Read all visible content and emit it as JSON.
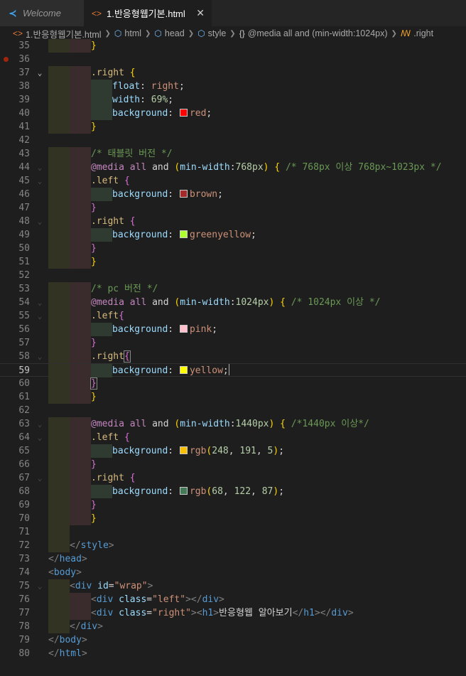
{
  "tabs": [
    {
      "label": "Welcome",
      "icon": "vscode-logo-icon",
      "active": false
    },
    {
      "label": "1.반응형웹기본.html",
      "icon": "html-file-icon",
      "active": true,
      "close": "✕"
    }
  ],
  "breadcrumbs": [
    "1.반응형웹기본.html",
    "html",
    "head",
    "style",
    "@media all and (min-width:1024px)",
    ".right"
  ],
  "lines": [
    {
      "n": "35",
      "ind": 2,
      "tokens": [
        {
          "t": "}",
          "c": "t-b1"
        }
      ]
    },
    {
      "n": "36",
      "ind": 0,
      "tokens": [],
      "breakpoint": true
    },
    {
      "n": "37",
      "ind": 2,
      "fold": "open",
      "tokens": [
        {
          "t": ".right",
          "c": "t-sel"
        },
        {
          "t": " "
        },
        {
          "t": "{",
          "c": "t-b1"
        }
      ]
    },
    {
      "n": "38",
      "ind": 3,
      "tokens": [
        {
          "t": "float",
          "c": "t-prop"
        },
        {
          "t": ": "
        },
        {
          "t": "right",
          "c": "t-val"
        },
        {
          "t": ";"
        }
      ]
    },
    {
      "n": "39",
      "ind": 3,
      "tokens": [
        {
          "t": "width",
          "c": "t-prop"
        },
        {
          "t": ": "
        },
        {
          "t": "69%",
          "c": "t-num"
        },
        {
          "t": ";"
        }
      ]
    },
    {
      "n": "40",
      "ind": 3,
      "tokens": [
        {
          "t": "background",
          "c": "t-prop"
        },
        {
          "t": ": "
        },
        {
          "sw": "#ff0000"
        },
        {
          "t": "red",
          "c": "t-val"
        },
        {
          "t": ";"
        }
      ]
    },
    {
      "n": "41",
      "ind": 2,
      "tokens": [
        {
          "t": "}",
          "c": "t-b1"
        }
      ]
    },
    {
      "n": "42",
      "ind": 0,
      "tokens": []
    },
    {
      "n": "43",
      "ind": 2,
      "tokens": [
        {
          "t": "/* 태블릿 버전 */",
          "c": "t-com"
        }
      ]
    },
    {
      "n": "44",
      "ind": 2,
      "fold": "dim",
      "tokens": [
        {
          "t": "@media",
          "c": "t-at"
        },
        {
          "t": " all ",
          "c": "t-at"
        },
        {
          "t": "and",
          "c": "t-txt"
        },
        {
          "t": " "
        },
        {
          "t": "(",
          "c": "t-b1"
        },
        {
          "t": "min-width",
          "c": "t-prop"
        },
        {
          "t": ":"
        },
        {
          "t": "768px",
          "c": "t-num"
        },
        {
          "t": ")",
          "c": "t-b1"
        },
        {
          "t": " "
        },
        {
          "t": "{",
          "c": "t-b1"
        },
        {
          "t": " /* 768px 이상 768px~1023px */",
          "c": "t-com"
        }
      ]
    },
    {
      "n": "45",
      "ind": 2,
      "fold": "dim",
      "tokens": [
        {
          "t": ".left",
          "c": "t-sel"
        },
        {
          "t": " "
        },
        {
          "t": "{",
          "c": "t-b2"
        }
      ]
    },
    {
      "n": "46",
      "ind": 3,
      "tokens": [
        {
          "t": "background",
          "c": "t-prop"
        },
        {
          "t": ": "
        },
        {
          "sw": "#a52a2a"
        },
        {
          "t": "brown",
          "c": "t-val"
        },
        {
          "t": ";"
        }
      ]
    },
    {
      "n": "47",
      "ind": 2,
      "tokens": [
        {
          "t": "}",
          "c": "t-b2"
        }
      ]
    },
    {
      "n": "48",
      "ind": 2,
      "fold": "dim",
      "tokens": [
        {
          "t": ".right",
          "c": "t-sel"
        },
        {
          "t": " "
        },
        {
          "t": "{",
          "c": "t-b2"
        }
      ]
    },
    {
      "n": "49",
      "ind": 3,
      "tokens": [
        {
          "t": "background",
          "c": "t-prop"
        },
        {
          "t": ": "
        },
        {
          "sw": "#adff2f"
        },
        {
          "t": "greenyellow",
          "c": "t-val"
        },
        {
          "t": ";"
        }
      ]
    },
    {
      "n": "50",
      "ind": 2,
      "tokens": [
        {
          "t": "}",
          "c": "t-b2"
        }
      ]
    },
    {
      "n": "51",
      "ind": 2,
      "tokens": [
        {
          "t": "}",
          "c": "t-b1"
        }
      ]
    },
    {
      "n": "52",
      "ind": 0,
      "tokens": []
    },
    {
      "n": "53",
      "ind": 2,
      "tokens": [
        {
          "t": "/* pc 버전 */",
          "c": "t-com"
        }
      ]
    },
    {
      "n": "54",
      "ind": 2,
      "fold": "dim",
      "tokens": [
        {
          "t": "@media",
          "c": "t-at"
        },
        {
          "t": " all ",
          "c": "t-at"
        },
        {
          "t": "and",
          "c": "t-txt"
        },
        {
          "t": " "
        },
        {
          "t": "(",
          "c": "t-b1"
        },
        {
          "t": "min-width",
          "c": "t-prop"
        },
        {
          "t": ":"
        },
        {
          "t": "1024px",
          "c": "t-num"
        },
        {
          "t": ")",
          "c": "t-b1"
        },
        {
          "t": " "
        },
        {
          "t": "{",
          "c": "t-b1"
        },
        {
          "t": " /* 1024px 이상 */",
          "c": "t-com"
        }
      ]
    },
    {
      "n": "55",
      "ind": 2,
      "fold": "dim",
      "tokens": [
        {
          "t": ".left",
          "c": "t-sel"
        },
        {
          "t": "{",
          "c": "t-b2"
        }
      ]
    },
    {
      "n": "56",
      "ind": 3,
      "tokens": [
        {
          "t": "background",
          "c": "t-prop"
        },
        {
          "t": ": "
        },
        {
          "sw": "#ffc0cb"
        },
        {
          "t": "pink",
          "c": "t-val"
        },
        {
          "t": ";"
        }
      ]
    },
    {
      "n": "57",
      "ind": 2,
      "tokens": [
        {
          "t": "}",
          "c": "t-b2"
        }
      ]
    },
    {
      "n": "58",
      "ind": 2,
      "fold": "dim",
      "tokens": [
        {
          "t": ".right",
          "c": "t-sel"
        },
        {
          "t": "{",
          "c": "t-b2",
          "match": true
        }
      ]
    },
    {
      "n": "59",
      "ind": 3,
      "current": true,
      "tokens": [
        {
          "t": "background",
          "c": "t-prop"
        },
        {
          "t": ": "
        },
        {
          "sw": "#ffff00"
        },
        {
          "t": "yellow",
          "c": "t-val"
        },
        {
          "t": ";"
        },
        {
          "cursor": true
        }
      ]
    },
    {
      "n": "60",
      "ind": 2,
      "tokens": [
        {
          "t": "}",
          "c": "t-b2",
          "match": true
        }
      ]
    },
    {
      "n": "61",
      "ind": 2,
      "tokens": [
        {
          "t": "}",
          "c": "t-b1"
        }
      ]
    },
    {
      "n": "62",
      "ind": 0,
      "tokens": []
    },
    {
      "n": "63",
      "ind": 2,
      "fold": "dim",
      "tokens": [
        {
          "t": "@media",
          "c": "t-at"
        },
        {
          "t": " all ",
          "c": "t-at"
        },
        {
          "t": "and",
          "c": "t-txt"
        },
        {
          "t": " "
        },
        {
          "t": "(",
          "c": "t-b1"
        },
        {
          "t": "min-width",
          "c": "t-prop"
        },
        {
          "t": ":"
        },
        {
          "t": "1440px",
          "c": "t-num"
        },
        {
          "t": ")",
          "c": "t-b1"
        },
        {
          "t": " "
        },
        {
          "t": "{",
          "c": "t-b1"
        },
        {
          "t": " /*1440px 이상*/",
          "c": "t-com"
        }
      ]
    },
    {
      "n": "64",
      "ind": 2,
      "fold": "dim",
      "tokens": [
        {
          "t": ".left",
          "c": "t-sel"
        },
        {
          "t": " "
        },
        {
          "t": "{",
          "c": "t-b2"
        }
      ]
    },
    {
      "n": "65",
      "ind": 3,
      "tokens": [
        {
          "t": "background",
          "c": "t-prop"
        },
        {
          "t": ": "
        },
        {
          "sw": "#f8bf05"
        },
        {
          "t": "rgb",
          "c": "t-val"
        },
        {
          "t": "(",
          "c": "t-b1"
        },
        {
          "t": "248",
          "c": "t-num"
        },
        {
          "t": ", "
        },
        {
          "t": "191",
          "c": "t-num"
        },
        {
          "t": ", "
        },
        {
          "t": "5",
          "c": "t-num"
        },
        {
          "t": ")",
          "c": "t-b1"
        },
        {
          "t": ";"
        }
      ]
    },
    {
      "n": "66",
      "ind": 2,
      "tokens": [
        {
          "t": "}",
          "c": "t-b2"
        }
      ]
    },
    {
      "n": "67",
      "ind": 2,
      "fold": "dim",
      "tokens": [
        {
          "t": ".right",
          "c": "t-sel"
        },
        {
          "t": " "
        },
        {
          "t": "{",
          "c": "t-b2"
        }
      ]
    },
    {
      "n": "68",
      "ind": 3,
      "tokens": [
        {
          "t": "background",
          "c": "t-prop"
        },
        {
          "t": ": "
        },
        {
          "sw": "#447a57"
        },
        {
          "t": "rgb",
          "c": "t-val"
        },
        {
          "t": "(",
          "c": "t-b1"
        },
        {
          "t": "68",
          "c": "t-num"
        },
        {
          "t": ", "
        },
        {
          "t": "122",
          "c": "t-num"
        },
        {
          "t": ", "
        },
        {
          "t": "87",
          "c": "t-num"
        },
        {
          "t": ")",
          "c": "t-b1"
        },
        {
          "t": ";"
        }
      ]
    },
    {
      "n": "69",
      "ind": 2,
      "tokens": [
        {
          "t": "}",
          "c": "t-b2"
        }
      ]
    },
    {
      "n": "70",
      "ind": 2,
      "tokens": [
        {
          "t": "}",
          "c": "t-b1"
        }
      ]
    },
    {
      "n": "71",
      "ind": 1,
      "tokens": []
    },
    {
      "n": "72",
      "ind": 1,
      "tokens": [
        {
          "t": "</",
          "c": "t-p"
        },
        {
          "t": "style",
          "c": "t-tag"
        },
        {
          "t": ">",
          "c": "t-p"
        }
      ]
    },
    {
      "n": "73",
      "ind": 0,
      "tokens": [
        {
          "t": "</",
          "c": "t-p"
        },
        {
          "t": "head",
          "c": "t-tag"
        },
        {
          "t": ">",
          "c": "t-p"
        }
      ]
    },
    {
      "n": "74",
      "ind": 0,
      "tokens": [
        {
          "t": "<",
          "c": "t-p"
        },
        {
          "t": "body",
          "c": "t-tag"
        },
        {
          "t": ">",
          "c": "t-p"
        }
      ]
    },
    {
      "n": "75",
      "ind": 1,
      "fold": "dim",
      "tokens": [
        {
          "t": "<",
          "c": "t-p"
        },
        {
          "t": "div",
          "c": "t-tag"
        },
        {
          "t": " "
        },
        {
          "t": "id",
          "c": "t-attr"
        },
        {
          "t": "="
        },
        {
          "t": "\"wrap\"",
          "c": "t-str"
        },
        {
          "t": ">",
          "c": "t-p"
        }
      ]
    },
    {
      "n": "76",
      "ind": 2,
      "tokens": [
        {
          "t": "<",
          "c": "t-p"
        },
        {
          "t": "div",
          "c": "t-tag"
        },
        {
          "t": " "
        },
        {
          "t": "class",
          "c": "t-attr"
        },
        {
          "t": "="
        },
        {
          "t": "\"left\"",
          "c": "t-str"
        },
        {
          "t": "></",
          "c": "t-p"
        },
        {
          "t": "div",
          "c": "t-tag"
        },
        {
          "t": ">",
          "c": "t-p"
        }
      ]
    },
    {
      "n": "77",
      "ind": 2,
      "tokens": [
        {
          "t": "<",
          "c": "t-p"
        },
        {
          "t": "div",
          "c": "t-tag"
        },
        {
          "t": " "
        },
        {
          "t": "class",
          "c": "t-attr"
        },
        {
          "t": "="
        },
        {
          "t": "\"right\"",
          "c": "t-str"
        },
        {
          "t": "><",
          "c": "t-p"
        },
        {
          "t": "h1",
          "c": "t-tag"
        },
        {
          "t": ">",
          "c": "t-p"
        },
        {
          "t": "반응형웹 알아보기",
          "c": "t-txt"
        },
        {
          "t": "</",
          "c": "t-p"
        },
        {
          "t": "h1",
          "c": "t-tag"
        },
        {
          "t": "></",
          "c": "t-p"
        },
        {
          "t": "div",
          "c": "t-tag"
        },
        {
          "t": ">",
          "c": "t-p"
        }
      ]
    },
    {
      "n": "78",
      "ind": 1,
      "tokens": [
        {
          "t": "</",
          "c": "t-p"
        },
        {
          "t": "div",
          "c": "t-tag"
        },
        {
          "t": ">",
          "c": "t-p"
        }
      ]
    },
    {
      "n": "79",
      "ind": 0,
      "tokens": [
        {
          "t": "</",
          "c": "t-p"
        },
        {
          "t": "body",
          "c": "t-tag"
        },
        {
          "t": ">",
          "c": "t-p"
        }
      ]
    },
    {
      "n": "80",
      "ind": 0,
      "tokens": [
        {
          "t": "</",
          "c": "t-p"
        },
        {
          "t": "html",
          "c": "t-tag"
        },
        {
          "t": ">",
          "c": "t-p"
        }
      ]
    }
  ]
}
